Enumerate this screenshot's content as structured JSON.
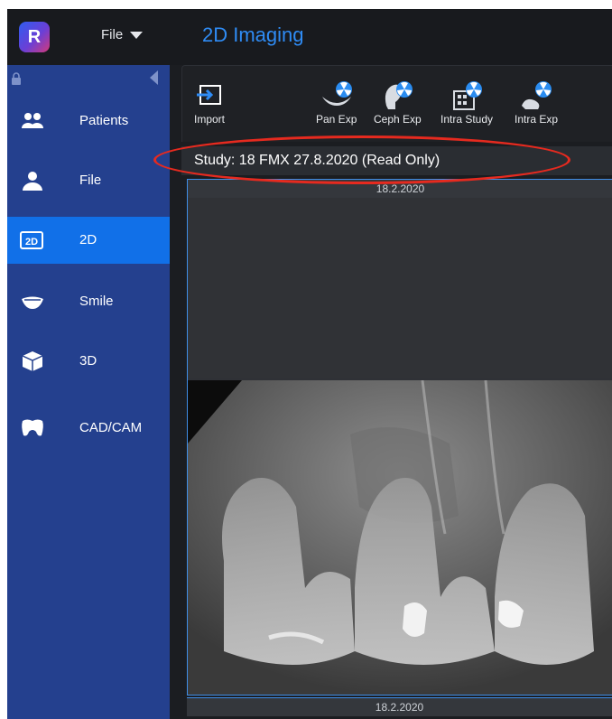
{
  "app": {
    "logo_letter": "R",
    "file_menu": "File",
    "title": "2D Imaging"
  },
  "sidebar": {
    "items": [
      {
        "label": "Patients",
        "icon": "patients-icon"
      },
      {
        "label": "File",
        "icon": "user-icon"
      },
      {
        "label": "2D",
        "icon": "2d-icon",
        "icon_text": "2D"
      },
      {
        "label": "Smile",
        "icon": "smile-icon"
      },
      {
        "label": "3D",
        "icon": "3d-cube-icon"
      },
      {
        "label": "CAD/CAM",
        "icon": "cadcam-tooth-icon"
      }
    ],
    "active": "2D"
  },
  "toolbar": {
    "tools": [
      {
        "label": "Import",
        "icon": "import-icon"
      },
      {
        "label": "Pan Exp",
        "icon": "pan-exposure-icon"
      },
      {
        "label": "Ceph Exp",
        "icon": "ceph-exposure-icon"
      },
      {
        "label": "Intra Study",
        "icon": "intra-study-icon"
      },
      {
        "label": "Intra Exp",
        "icon": "intra-exposure-icon"
      }
    ]
  },
  "study": {
    "header": "Study: 18 FMX  27.8.2020  (Read Only)"
  },
  "image_panel": {
    "date_top": "18.2.2020",
    "date_bottom": "18.2.2020"
  },
  "colors": {
    "sidebar_bg": "#24408e",
    "sidebar_active": "#1170e8",
    "title_blue": "#2f8cf5",
    "highlight_red": "#e62a1f",
    "panel_border": "#3f8ee8"
  }
}
